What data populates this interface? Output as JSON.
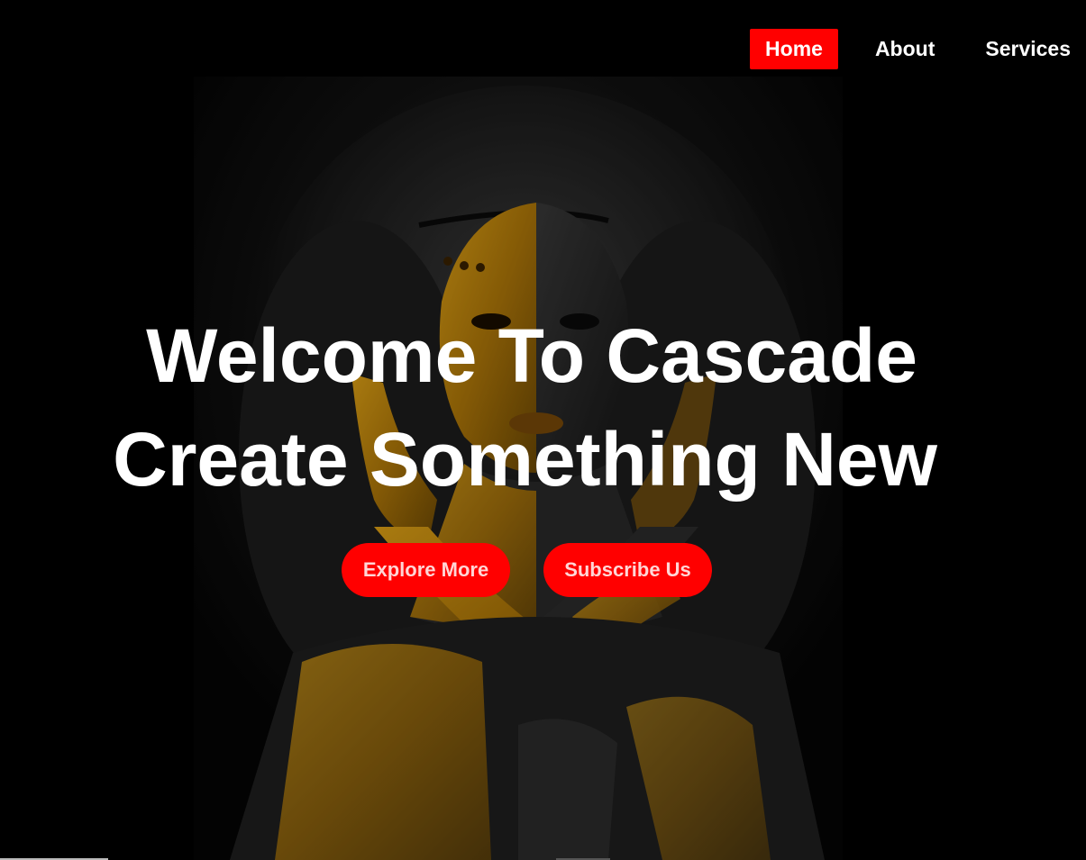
{
  "nav": {
    "items": [
      {
        "label": "Home",
        "active": true
      },
      {
        "label": "About",
        "active": false
      },
      {
        "label": "Services",
        "active": false
      }
    ]
  },
  "hero": {
    "title_line1": "Welcome To Cascade",
    "title_line2": "Create Something New",
    "buttons": {
      "explore": "Explore More",
      "subscribe": "Subscribe Us"
    },
    "image": "woman-gold-body-paint-photo"
  },
  "colors": {
    "accent": "#ff0000",
    "background": "#000000",
    "text": "#ffffff",
    "gold": "#c8900a"
  }
}
